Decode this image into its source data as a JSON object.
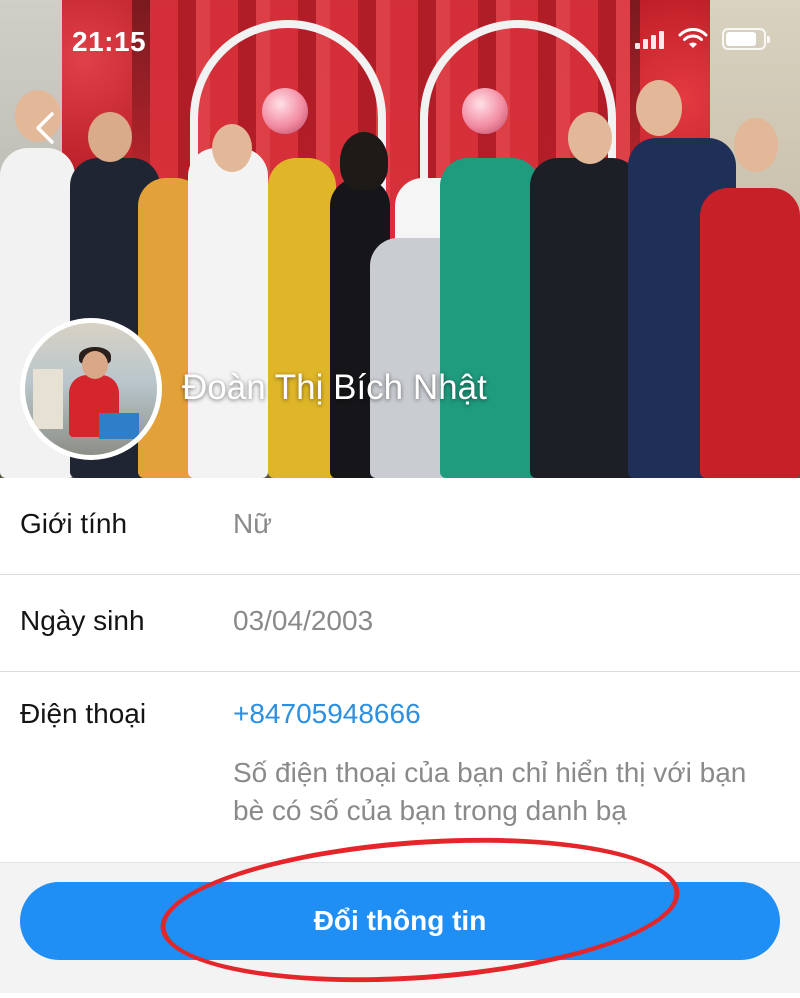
{
  "status_bar": {
    "time": "21:15"
  },
  "profile": {
    "name": "Đoàn Thị Bích Nhật"
  },
  "info": {
    "gender_label": "Giới tính",
    "gender_value": "Nữ",
    "birthday_label": "Ngày sinh",
    "birthday_value": "03/04/2003",
    "phone_label": "Điện thoại",
    "phone_value": "+84705948666",
    "phone_note": "Số điện thoại của bạn chỉ hiển thị với bạn bè có số của bạn trong danh bạ"
  },
  "actions": {
    "edit_label": "Đổi thông tin"
  },
  "icons": {
    "back": "chevron-left-icon",
    "wifi": "wifi-icon",
    "signal": "signal-icon",
    "battery": "battery-icon"
  },
  "colors": {
    "accent_button": "#1f8ef5",
    "phone_link": "#2d8fe0",
    "annotation_circle": "#e4262b"
  }
}
